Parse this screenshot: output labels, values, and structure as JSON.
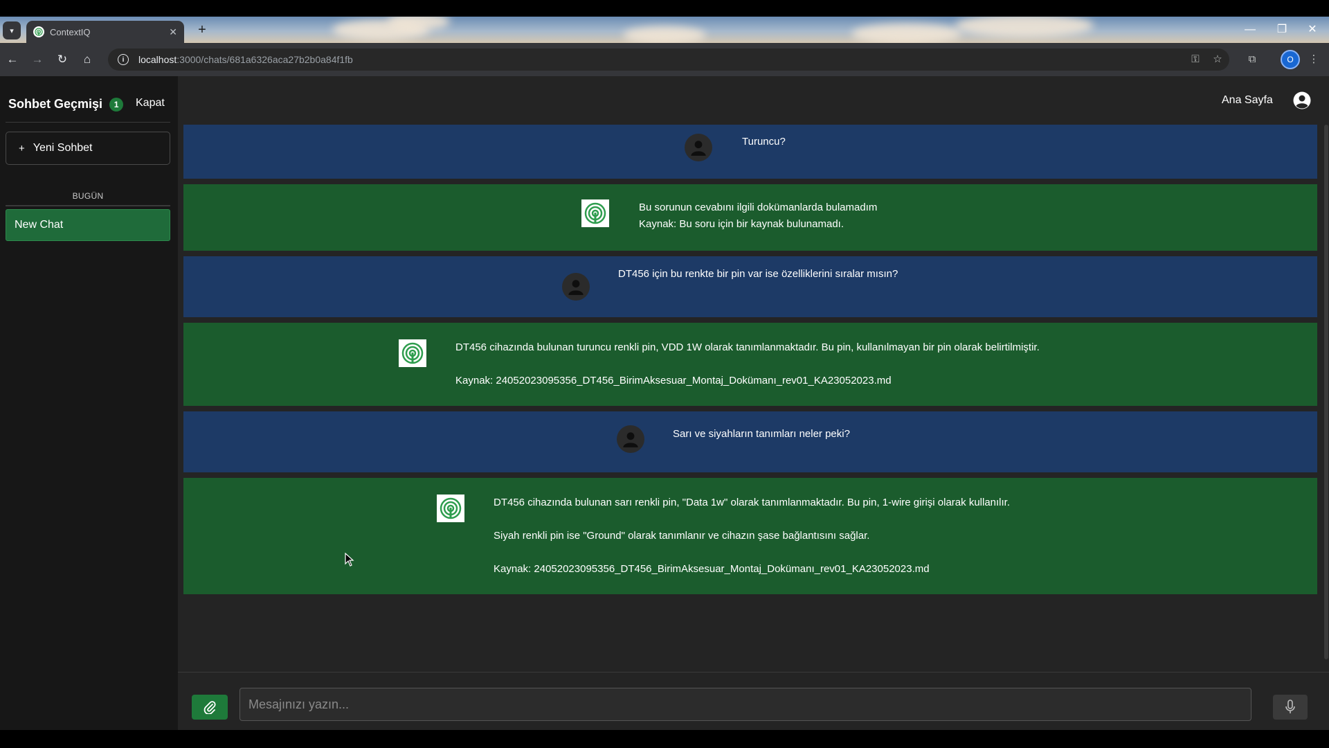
{
  "browser": {
    "tab_title": "ContextIQ",
    "url_host": "localhost",
    "url_path": ":3000/chats/681a6326aca27b2b0a84f1fb",
    "profile_initial": "O"
  },
  "sidebar": {
    "title": "Sohbet Geçmişi",
    "badge": "1",
    "close_label": "Kapat",
    "new_chat_label": "Yeni Sohbet",
    "section_label": "BUGÜN",
    "chats": [
      {
        "label": "New Chat"
      }
    ]
  },
  "header": {
    "home_label": "Ana Sayfa"
  },
  "messages": [
    {
      "role": "user",
      "lines": [
        "Turuncu?"
      ]
    },
    {
      "role": "bot",
      "lines": [
        "Bu sorunun cevabını ilgili dokümanlarda bulamadım",
        "Kaynak: Bu soru için bir kaynak bulunamadı."
      ]
    },
    {
      "role": "user",
      "lines": [
        "DT456 için bu renkte bir pin var ise özelliklerini sıralar mısın?"
      ]
    },
    {
      "role": "bot",
      "lines": [
        "DT456 cihazında bulunan turuncu renkli pin, VDD 1W olarak tanımlanmaktadır. Bu pin, kullanılmayan bir pin olarak belirtilmiştir.",
        "Kaynak: 24052023095356_DT456_BirimAksesuar_Montaj_Dokümanı_rev01_KA23052023.md"
      ]
    },
    {
      "role": "user",
      "lines": [
        "Sarı ve siyahların tanımları neler peki?"
      ]
    },
    {
      "role": "bot",
      "lines": [
        "DT456 cihazında bulunan sarı renkli pin, \"Data 1w\" olarak tanımlanmaktadır. Bu pin, 1-wire girişi olarak kullanılır.",
        "Siyah renkli pin ise \"Ground\" olarak tanımlanır ve cihazın şase bağlantısını sağlar.",
        "Kaynak: 24052023095356_DT456_BirimAksesuar_Montaj_Dokümanı_rev01_KA23052023.md"
      ]
    }
  ],
  "composer": {
    "placeholder": "Mesajınızı yazın..."
  },
  "colors": {
    "user_message_bg": "#1d3a66",
    "bot_message_bg": "#1b5c2d",
    "accent_green": "#1e7a3a"
  }
}
